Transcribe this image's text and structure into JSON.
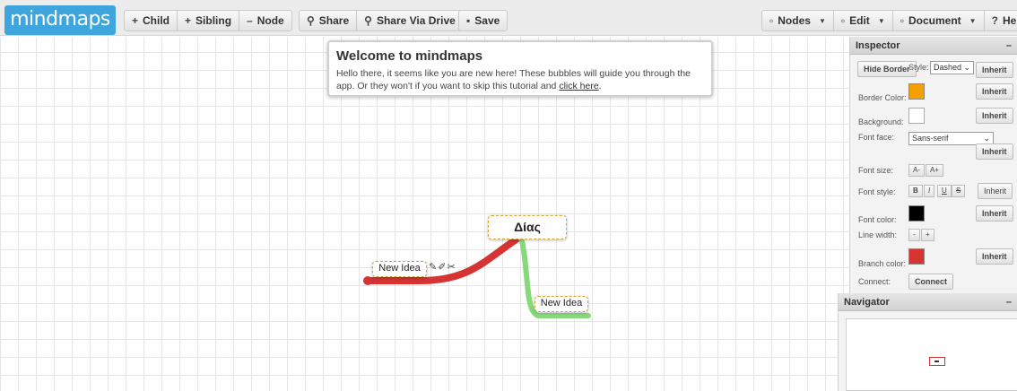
{
  "app": {
    "logo": "mindmaps"
  },
  "toolbar": {
    "child": "Child",
    "sibling": "Sibling",
    "node": "Node",
    "share": "Share",
    "share_drive": "Share Via Drive",
    "save": "Save",
    "nodes_menu": "Nodes",
    "edit_menu": "Edit",
    "document_menu": "Document",
    "help_menu": "Help"
  },
  "welcome": {
    "title": "Welcome to mindmaps",
    "text": "Hello there, it seems like you are new here! These bubbles will guide you through the app. Or they won't if you want to skip this tutorial and",
    "link": "click here",
    "end": "."
  },
  "mindmap": {
    "root": "Δίας",
    "child_left": "New Idea",
    "child_right": "New Idea",
    "branch_colors": {
      "left": "#d63333",
      "right": "#86d97a"
    }
  },
  "inspector": {
    "title": "Inspector",
    "collapse": "–",
    "hide_border": "Hide Border",
    "style_label": "Style:",
    "style_value": "Dashed",
    "inherit": "Inherit",
    "border_color_label": "Border Color:",
    "border_color": "#f5a000",
    "background_label": "Background:",
    "background_color": "#ffffff",
    "font_face_label": "Font face:",
    "font_face_value": "Sans-serif",
    "font_size_label": "Font size:",
    "font_size_down": "A-",
    "font_size_up": "A+",
    "font_style_label": "Font style:",
    "bold": "B",
    "italic": "I",
    "underline": "U",
    "strike": "S",
    "font_color_label": "Font color:",
    "font_color": "#000000",
    "line_width_label": "Line width:",
    "line_minus": "-",
    "line_plus": "+",
    "branch_color_label": "Branch color:",
    "branch_color": "#d63333",
    "connect_label": "Connect:",
    "connect_button": "Connect"
  },
  "navigator": {
    "title": "Navigator",
    "collapse": "–"
  }
}
